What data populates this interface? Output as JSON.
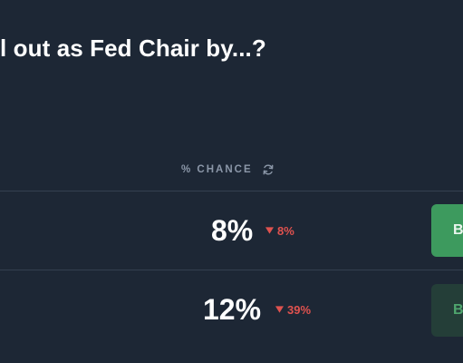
{
  "question": {
    "title": "l out as Fed Chair by...?"
  },
  "table": {
    "chance_header": "% CHANCE",
    "refresh_icon": "refresh-icon",
    "rows": [
      {
        "chance": "8%",
        "delta": "8%",
        "delta_direction": "down",
        "buy_label": "B"
      },
      {
        "chance": "12%",
        "delta": "39%",
        "delta_direction": "down",
        "buy_label": "Bu"
      }
    ]
  },
  "colors": {
    "background": "#1d2735",
    "text": "#ffffff",
    "muted_text": "#8b97a8",
    "down": "#e0524f",
    "buy_primary": "#3d9a5e",
    "buy_muted_bg": "#243e38",
    "buy_muted_text": "#4fa66e"
  }
}
